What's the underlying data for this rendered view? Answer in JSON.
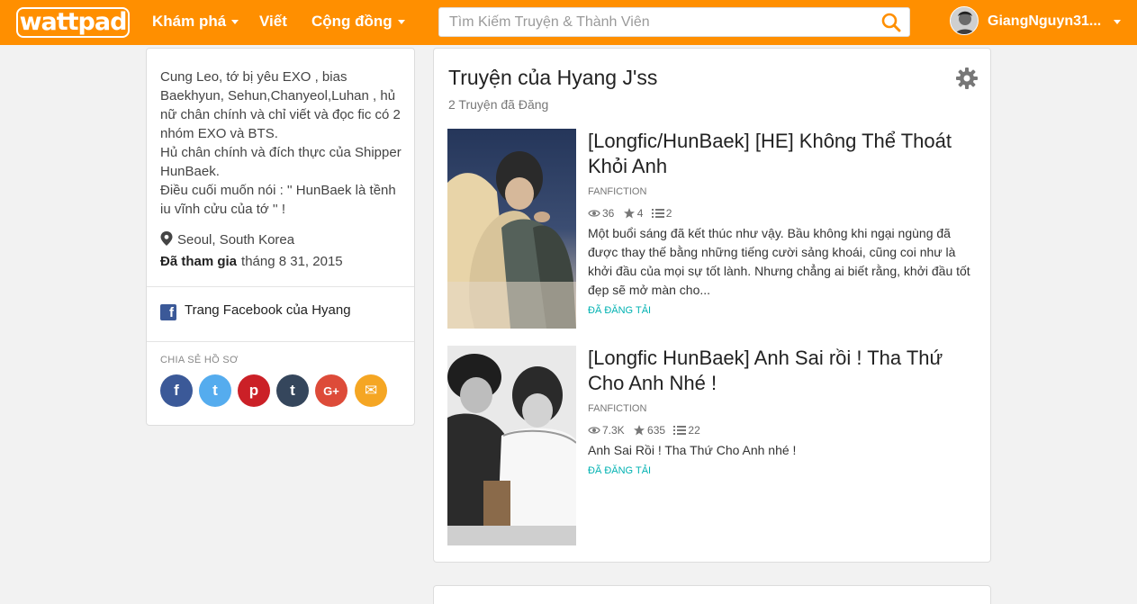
{
  "header": {
    "logo_text": "wattpad",
    "nav": {
      "discover": "Khám phá",
      "write": "Viết",
      "community": "Cộng đồng"
    },
    "search": {
      "placeholder": "Tìm Kiếm Truyện & Thành Viên",
      "value": ""
    },
    "user": {
      "name": "GiangNguyn31..."
    },
    "colors": {
      "brand": "#ff8f00"
    }
  },
  "profile": {
    "bio_lines": [
      "Cung Leo, tớ bị yêu EXO , bias Baekhyun, Sehun,Chanyeol,Luhan  , hủ nữ chân chính và chỉ viết và đọc fic có 2 nhóm EXO và BTS.",
      "Hủ chân chính và đích thực của Shipper HunBaek.",
      "Điều cuối muốn nói : '' HunBaek là tềnh iu vĩnh cửu của tớ '' !"
    ],
    "location": "Seoul, South Korea",
    "joined_label": "Đã tham gia",
    "joined_date": "tháng 8 31, 2015",
    "facebook_link": "Trang Facebook của Hyang",
    "share_label": "CHIA SẺ HỒ SƠ",
    "share_buttons": [
      {
        "icon": "facebook-icon",
        "glyph": "f",
        "color": "#3b5998"
      },
      {
        "icon": "twitter-icon",
        "glyph": "t",
        "color": "#55acee"
      },
      {
        "icon": "pinterest-icon",
        "glyph": "p",
        "color": "#cb2027"
      },
      {
        "icon": "tumblr-icon",
        "glyph": "t",
        "color": "#35465c"
      },
      {
        "icon": "google-plus-icon",
        "glyph": "G+",
        "color": "#dd4b39"
      },
      {
        "icon": "email-icon",
        "glyph": "✉",
        "color": "#f5a623"
      }
    ]
  },
  "stories": {
    "title": "Truyện của Hyang J'ss",
    "count": "2 Truyện đã Đăng",
    "items": [
      {
        "title": "[Longfic/HunBaek] [HE] Không Thể Thoát Khỏi Anh",
        "category": "FANFICTION",
        "reads": "36",
        "votes": "4",
        "parts": "2",
        "description": "Một buổi sáng đã kết thúc như vậy. Bầu không khi ngại ngùng đã được thay thế bằng những tiếng cười sảng khoái, cũng coi như là khởi đầu của mọi sự tốt lành. Nhưng chẳng ai biết rằng, khởi đầu tốt đẹp sẽ mở màn cho...",
        "status": "ĐÃ ĐĂNG TẢI"
      },
      {
        "title": "[Longfic HunBaek] Anh Sai rồi ! Tha Thứ Cho Anh Nhé !",
        "category": "FANFICTION",
        "reads": "7.3K",
        "votes": "635",
        "parts": "22",
        "description": "Anh Sai Rồi ! Tha Thứ Cho Anh nhé !",
        "status": "ĐÃ ĐĂNG TẢI"
      }
    ]
  },
  "accent_colors": {
    "status": "#00b2b2"
  }
}
